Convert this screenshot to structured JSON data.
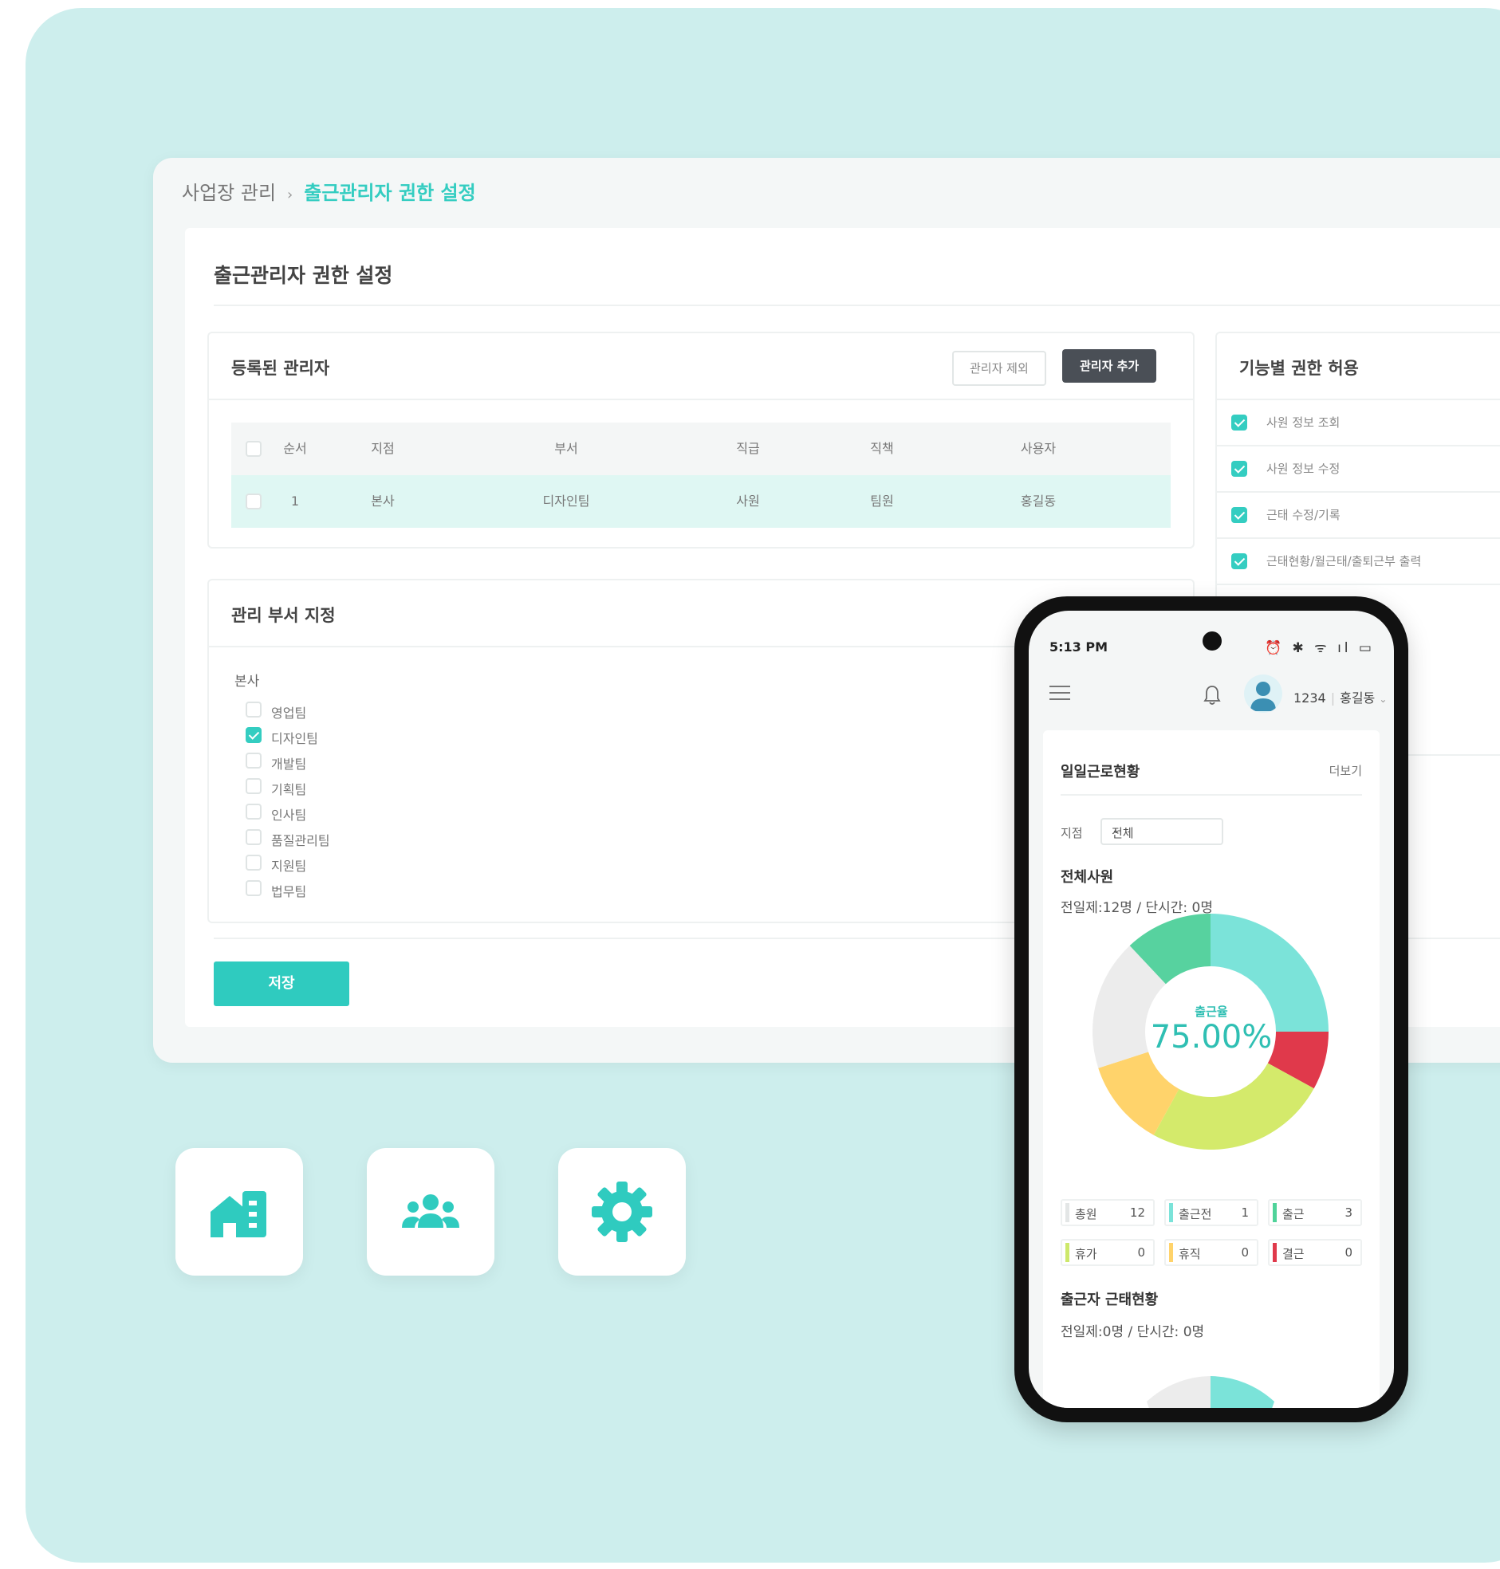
{
  "colors": {
    "accent": "#34cdc1",
    "background": "#cdeeed",
    "dark_button": "#4a4f56"
  },
  "desktop": {
    "breadcrumb": {
      "parent": "사업장 관리",
      "separator": "›",
      "current": "출근관리자 권한 설정"
    },
    "page_title": "출근관리자 권한 설정",
    "registered_panel": {
      "title": "등록된 관리자",
      "remove_button": "관리자 제외",
      "add_button": "관리자 추가",
      "columns": [
        "순서",
        "지점",
        "부서",
        "직급",
        "직책",
        "사용자"
      ],
      "rows": [
        {
          "selected": true,
          "cells": [
            "1",
            "본사",
            "디자인팀",
            "사원",
            "팀원",
            "홍길동"
          ]
        }
      ]
    },
    "dept_panel": {
      "title": "관리 부서 지정",
      "group": "본사",
      "departments": [
        {
          "label": "영업팀",
          "checked": false
        },
        {
          "label": "디자인팀",
          "checked": true
        },
        {
          "label": "개발팀",
          "checked": false
        },
        {
          "label": "기획팀",
          "checked": false
        },
        {
          "label": "인사팀",
          "checked": false
        },
        {
          "label": "품질관리팀",
          "checked": false
        },
        {
          "label": "지원팀",
          "checked": false
        },
        {
          "label": "법무팀",
          "checked": false
        }
      ]
    },
    "permission_panel": {
      "title": "기능별 권한 허용",
      "items": [
        {
          "label": "사원 정보 조회",
          "checked": true
        },
        {
          "label": "사원 정보 수정",
          "checked": true
        },
        {
          "label": "근태 수정/기록",
          "checked": true
        },
        {
          "label": "근태현황/월근태/출퇴근부 출력",
          "checked": true
        }
      ]
    },
    "save_button": "저장"
  },
  "tiles": [
    {
      "icon": "building-home-icon"
    },
    {
      "icon": "people-group-icon"
    },
    {
      "icon": "gear-icon"
    }
  ],
  "phone": {
    "status_time": "5:13 PM",
    "status_icons": "⏰ ✱ ᯤ ıl ▭",
    "user_id": "1234",
    "user_name": "홍길동",
    "daily": {
      "title": "일일근로현황",
      "more": "더보기",
      "branch_label": "지점",
      "branch_value": "전체",
      "all_staff_title": "전체사원",
      "all_staff_sub": "전일제:12명 / 단시간: 0명",
      "rate_label": "출근율",
      "rate_value": "75.00%",
      "stats": [
        {
          "label": "총원",
          "value": "12",
          "color": "#e3e6e6"
        },
        {
          "label": "출근전",
          "value": "1",
          "color": "#7be3d9"
        },
        {
          "label": "출근",
          "value": "3",
          "color": "#4fd39a"
        },
        {
          "label": "휴가",
          "value": "0",
          "color": "#cde86a"
        },
        {
          "label": "휴직",
          "value": "0",
          "color": "#ffd36b"
        },
        {
          "label": "결근",
          "value": "0",
          "color": "#e0394b"
        }
      ],
      "attendee_title": "출근자 근태현황",
      "attendee_sub": "전일제:0명 / 단시간: 0명"
    }
  },
  "chart_data": {
    "type": "pie",
    "slices": [
      {
        "color": "#7be3d9",
        "value": 25
      },
      {
        "color": "#e0394b",
        "value": 8
      },
      {
        "color": "#d4ea6b",
        "value": 25
      },
      {
        "color": "#ffd36b",
        "value": 12
      },
      {
        "color": "#ececec",
        "value": 18
      },
      {
        "color": "#57d29f",
        "value": 12
      }
    ],
    "center_label": "출근율",
    "center_value": "75.00%"
  }
}
